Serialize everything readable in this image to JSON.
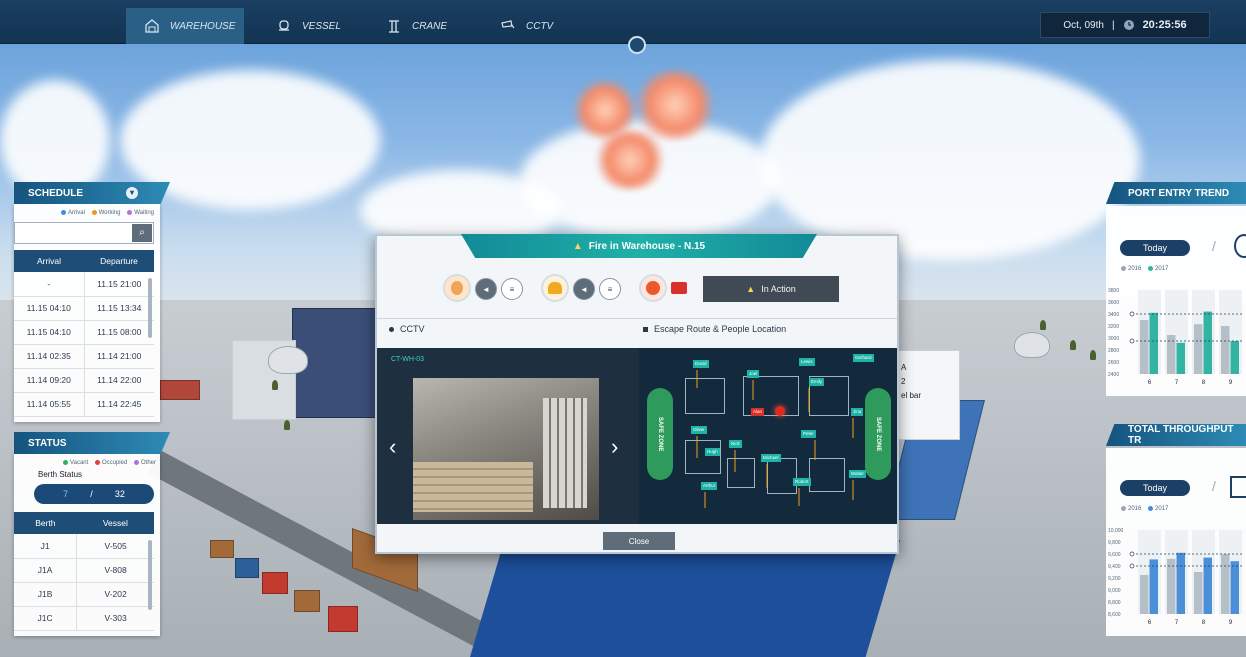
{
  "nav": {
    "tabs": [
      {
        "label": "WAREHOUSE",
        "icon": "warehouse-icon",
        "active": true
      },
      {
        "label": "VESSEL",
        "icon": "vessel-icon",
        "active": false
      },
      {
        "label": "CRANE",
        "icon": "crane-icon",
        "active": false
      },
      {
        "label": "CCTV",
        "icon": "cctv-icon",
        "active": false
      }
    ],
    "date": "Oct, 09th",
    "separator": "|",
    "time": "20:25:56"
  },
  "schedule": {
    "title": "SCHEDULE",
    "legend": [
      "Arrival",
      "Working",
      "Waiting"
    ],
    "legend_colors": [
      "#3c8fe0",
      "#f0922f",
      "#b86de0"
    ],
    "columns": [
      "Arrival",
      "Departure"
    ],
    "rows": [
      [
        "-",
        "11.15 21:00"
      ],
      [
        "11.15 04:10",
        "11.15 13:34"
      ],
      [
        "11.15 04:10",
        "11.15 08:00"
      ],
      [
        "11.14 02:35",
        "11.14 21:00"
      ],
      [
        "11.14 09:20",
        "11.14 22:00"
      ],
      [
        "11.14 05:55",
        "11.14 22:45"
      ]
    ]
  },
  "status": {
    "title": "STATUS",
    "legend": [
      "Vacant",
      "Occupied",
      "Other"
    ],
    "legend_colors": [
      "#2fae66",
      "#e04040",
      "#b86de0"
    ],
    "berth_label": "Berth Status",
    "berth_value": "7",
    "berth_sep": "/",
    "berth_total": "32",
    "columns": [
      "Berth",
      "Vessel"
    ],
    "rows": [
      [
        "J1",
        "V-505"
      ],
      [
        "J1A",
        "V-808"
      ],
      [
        "J1B",
        "V-202"
      ],
      [
        "J1C",
        "V-303"
      ]
    ]
  },
  "port_entry": {
    "title": "PORT ENTRY TREND",
    "today": "Today",
    "legend": [
      "2016",
      "2017"
    ],
    "sep": "/"
  },
  "throughput": {
    "title": "TOTAL THROUGHPUT TR",
    "today": "Today",
    "legend": [
      "2016",
      "2017"
    ],
    "sep": "/"
  },
  "chart_data": [
    {
      "type": "bar",
      "title": "PORT ENTRY TREND",
      "categories": [
        "6",
        "7",
        "8",
        "9"
      ],
      "yticks": [
        "3800",
        "3600",
        "3400",
        "3200",
        "3000",
        "2800",
        "2600",
        "2400"
      ],
      "ylim": [
        2400,
        3800
      ],
      "series": [
        {
          "name": "2016",
          "values": [
            3300,
            3050,
            3230,
            3200
          ]
        },
        {
          "name": "2017",
          "values": [
            3420,
            2920,
            3440,
            2950
          ]
        }
      ],
      "reference_lines": [
        3400,
        2950
      ]
    },
    {
      "type": "bar",
      "title": "TOTAL THROUGHPUT TR",
      "categories": [
        "6",
        "7",
        "8",
        "9"
      ],
      "yticks": [
        "10,000",
        "9,800",
        "9,600",
        "9,400",
        "9,200",
        "9,000",
        "8,800",
        "8,600"
      ],
      "ylim": [
        8600,
        10000
      ],
      "series": [
        {
          "name": "2016",
          "values": [
            9250,
            9520,
            9300,
            9600
          ]
        },
        {
          "name": "2017",
          "values": [
            9510,
            9620,
            9540,
            9480
          ]
        }
      ],
      "reference_lines": [
        9600,
        9400
      ]
    }
  ],
  "alert": {
    "title": "Fire in Warehouse - N.15",
    "status": "In Action",
    "cctv_label": "CCTV",
    "escape_label": "Escape Route & People Location",
    "camera_id": "CT-WH-03",
    "safe_zone": "SAFE ZONE",
    "close": "Close",
    "people": [
      "David",
      "Lewis",
      "Gerhard",
      "Joel",
      "Emily",
      "Alan",
      "Jina",
      "Oliver",
      "Peter",
      "Hugh",
      "Nick",
      "Michael",
      "Walter",
      "Arthur",
      "Robert"
    ]
  },
  "bg_callout": {
    "line1": "A",
    "line2": "2",
    "line3": "el bar"
  }
}
